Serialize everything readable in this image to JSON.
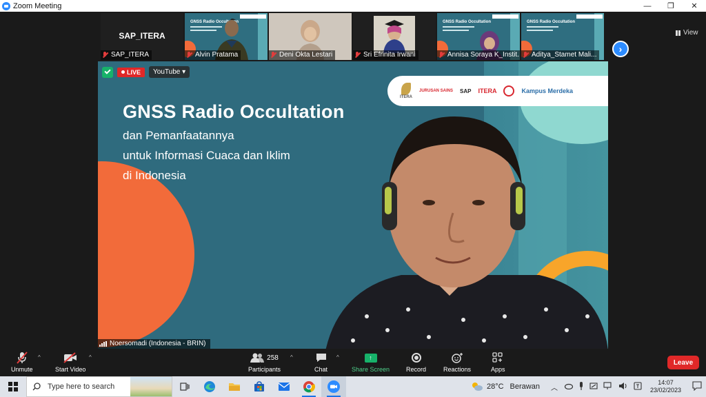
{
  "window": {
    "title": "Zoom Meeting",
    "controls": [
      "—",
      "❐",
      "✕"
    ]
  },
  "gallery": {
    "participants": [
      {
        "name": "SAP_ITERA",
        "center_label": "SAP_ITERA"
      },
      {
        "name": "Alvin Pratama"
      },
      {
        "name": "Deni Okta Lestari"
      },
      {
        "name": "Sri Efrinita Irwani"
      },
      {
        "name": "Annisa Soraya K_Instit..."
      },
      {
        "name": "Aditya_Stamet Mali..."
      }
    ],
    "next_label": "›",
    "view_label": "View"
  },
  "main": {
    "live_label": "LIVE",
    "stream_label": "YouTube",
    "stream_caret": "▾",
    "slide_title": "GNSS Radio Occultation",
    "slide_lines": [
      "dan Pemanfaatannya",
      "untuk Informasi Cuaca dan Iklim",
      "di Indonesia"
    ],
    "logos": {
      "itera": "ITERA",
      "jurusan": "JURUSAN SAINS",
      "sap": "SAP",
      "itera_red": "ITERA",
      "kampus": "Kampus Merdeka"
    },
    "speaker_name": "Noersomadi (Indonesia - BRIN)"
  },
  "controls": {
    "unmute": "Unmute",
    "start_video": "Start Video",
    "participants": "Participants",
    "participants_count": "258",
    "chat": "Chat",
    "share_screen": "Share Screen",
    "record": "Record",
    "reactions": "Reactions",
    "apps": "Apps",
    "leave": "Leave",
    "caret": "^"
  },
  "taskbar": {
    "search_placeholder": "Type here to search",
    "weather_temp": "28°C",
    "weather_desc": "Berawan",
    "time": "14:07",
    "date": "23/02/2023"
  },
  "colors": {
    "slide_bg": "#2f6b7e",
    "accent_blue": "#2d8cff",
    "leave_red": "#e02828",
    "share_green": "#17b26a",
    "orange": "#f26b3a"
  }
}
